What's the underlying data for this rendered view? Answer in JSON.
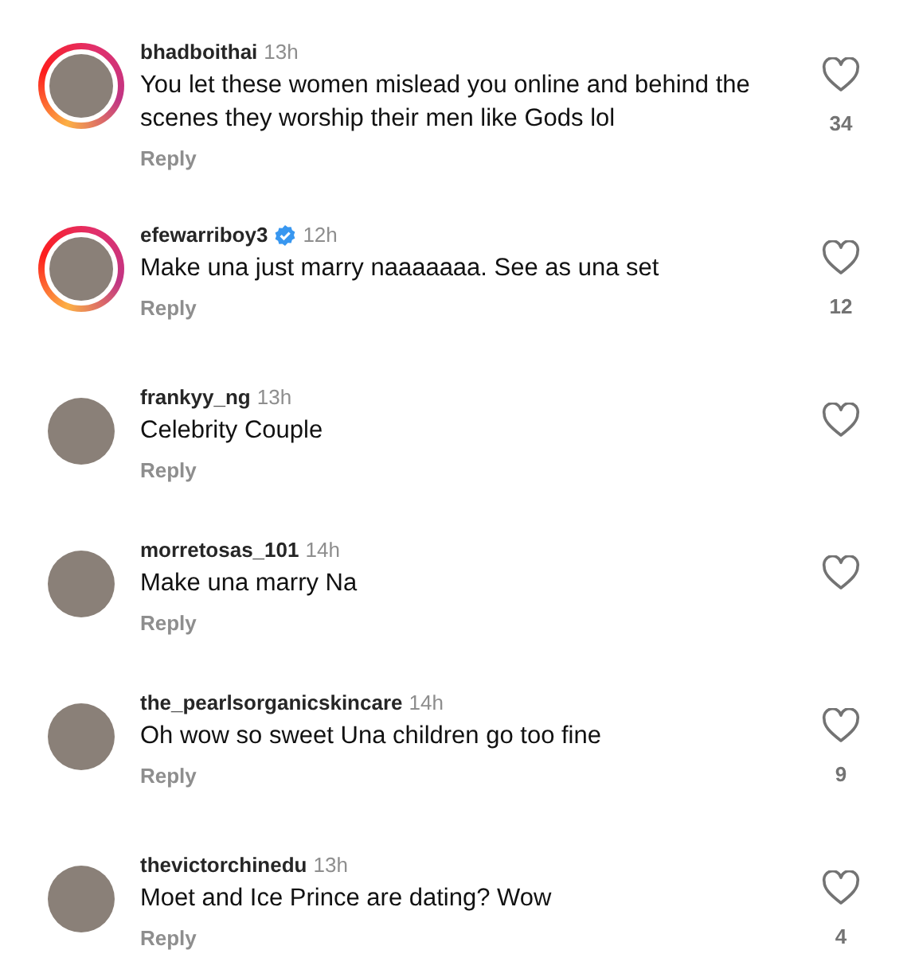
{
  "comments": [
    {
      "username": "bhadboithai",
      "time": "13h",
      "verified": false,
      "story": true,
      "text": "You let these women mislead you online and behind the scenes they worship their men like Gods lol",
      "reply": "Reply",
      "liked": false,
      "likes": "34"
    },
    {
      "username": "efewarriboy3",
      "time": "12h",
      "verified": true,
      "story": true,
      "text": "Make una just marry naaaaaaa. See as una set",
      "reply": "Reply",
      "liked": false,
      "likes": "12"
    },
    {
      "username": "frankyy_ng",
      "time": "13h",
      "verified": false,
      "story": false,
      "text": "Celebrity Couple",
      "reply": "Reply",
      "liked": false
    },
    {
      "username": "morretosas_101",
      "time": "14h",
      "verified": false,
      "story": false,
      "text": "Make una marry Na",
      "reply": "Reply",
      "liked": false
    },
    {
      "username": "the_pearlsorganicskincare",
      "time": "14h",
      "verified": false,
      "story": false,
      "text": "Oh wow so sweet Una children go too fine",
      "reply": "Reply",
      "liked": false,
      "likes": "9"
    },
    {
      "username": "thevictorchinedu",
      "time": "13h",
      "verified": false,
      "story": false,
      "text": "Moet and Ice Prince are dating? Wow",
      "reply": "Reply",
      "liked": false,
      "likes": "4"
    }
  ]
}
